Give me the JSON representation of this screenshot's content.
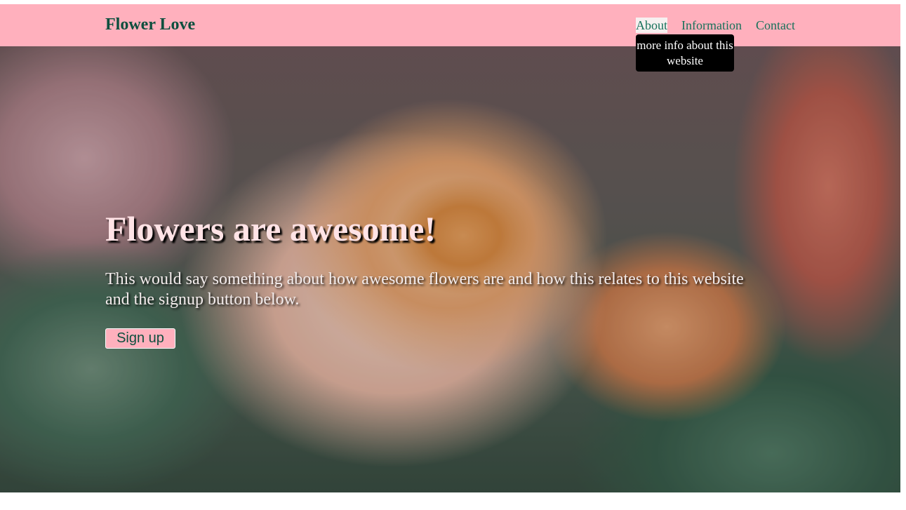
{
  "header": {
    "brand": "Flower Love",
    "nav": [
      {
        "label": "About",
        "tooltip": "more info about this website"
      },
      {
        "label": "Information"
      },
      {
        "label": "Contact"
      }
    ]
  },
  "hero": {
    "headline": "Flowers are awesome!",
    "lead": "This would say something about how awesome flowers are and how this relates to this website and the signup button below.",
    "button_label": "Sign up",
    "background_image": "rose-photo"
  },
  "colors": {
    "navbar_bg": "#ffb0bd",
    "brand_text": "#0d4f3e",
    "nav_link": "#17715a",
    "tooltip_bg": "#000000",
    "button_bg": "#ffb0bd"
  }
}
